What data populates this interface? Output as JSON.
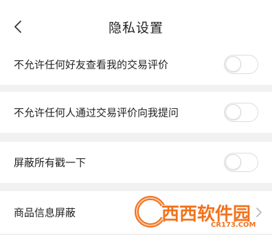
{
  "header": {
    "back_icon": "chevron-left-icon",
    "title": "隐私设置"
  },
  "settings": [
    {
      "label": "不允许任何好友查看我的交易评价",
      "control": "toggle",
      "enabled": false
    },
    {
      "label": "不允许任何人通过交易评价向我提问",
      "control": "toggle",
      "enabled": false
    },
    {
      "label": "屏蔽所有戳一下",
      "control": "toggle",
      "enabled": false
    },
    {
      "label": "商品信息屏蔽",
      "control": "chevron-right-icon"
    }
  ],
  "watermark": {
    "brand": "西西软件园",
    "url": "CR173.COM"
  },
  "colors": {
    "background": "#ffffff",
    "section_gap": "#f1f1f1",
    "toggle_border": "#dcdcdc",
    "text": "#222222",
    "watermark_orange": "#f2721c"
  }
}
